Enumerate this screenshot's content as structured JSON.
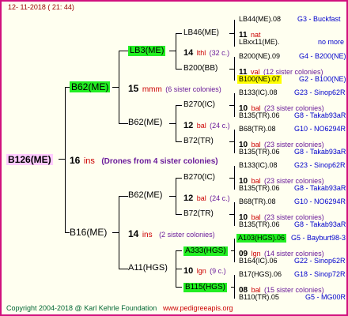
{
  "header": {
    "timestamp": "12- 11-2018 ( 21: 44)"
  },
  "tree": {
    "root": {
      "name": "B126(ME)"
    },
    "gen1": {
      "label": "16",
      "code": "ins",
      "note": "(Drones from 4 sister colonies)",
      "top": "B62(ME)",
      "bottom": "B16(ME)"
    },
    "gen2": {
      "b62_label": "15",
      "b62_code": "mmm",
      "b62_note": "(6 sister colonies)",
      "b16_label": "14",
      "b16_code": "ins",
      "b16_note": "(2 sister colonies)",
      "b62_top": "LB3(ME)",
      "b62_bottom": "B62(ME)",
      "b16_top": "B62(ME)",
      "b16_bottom": "A11(HGS)"
    },
    "gen3": {
      "lb3_label": "14",
      "lb3_code": "lthl",
      "lb3_note": "(32 c.)",
      "lb3_top": "LB46(ME)",
      "lb3_bottom": "B200(BB)",
      "b62a_label": "12",
      "b62a_code": "bal",
      "b62a_note": "(24 c.)",
      "b62a_top": "B270(IC)",
      "b62a_bottom": "B72(TR)",
      "b62b_label": "12",
      "b62b_code": "bal",
      "b62b_note": "(24 c.)",
      "b62b_top": "B270(IC)",
      "b62b_bottom": "B72(TR)",
      "a11_label": "10",
      "a11_code": "lgn",
      "a11_note": "(9 c.)",
      "a11_top": "A333(HGS)",
      "a11_bottom": "B115(HGS)"
    },
    "gen4": [
      {
        "name": "LB44(ME).08",
        "origin": "G3 - Buckfast"
      },
      {
        "label": "11",
        "code": "nat"
      },
      {
        "name": "LBxx11(ME).",
        "origin": "no more"
      },
      {
        "name": "B200(NE).09",
        "origin": "G4 - B200(NE)"
      },
      {
        "label": "11",
        "code": "val",
        "note": "(12 sister colonies)"
      },
      {
        "name": "B100(NE).07",
        "origin": "G2 - B100(NE)"
      },
      {
        "name": "B133(IC).08",
        "origin": "G23 - Sinop62R"
      },
      {
        "label": "10",
        "code": "bal",
        "note": "(23 sister colonies)"
      },
      {
        "name": "B135(TR).06",
        "origin": "G8 - Takab93aR"
      },
      {
        "name": "B68(TR).08",
        "origin": "G10 - NO6294R"
      },
      {
        "label": "10",
        "code": "bal",
        "note": "(23 sister colonies)"
      },
      {
        "name": "B135(TR).06",
        "origin": "G8 - Takab93aR"
      },
      {
        "name": "B133(IC).08",
        "origin": "G23 - Sinop62R"
      },
      {
        "label": "10",
        "code": "bal",
        "note": "(23 sister colonies)"
      },
      {
        "name": "B135(TR).06",
        "origin": "G8 - Takab93aR"
      },
      {
        "name": "B68(TR).08",
        "origin": "G10 - NO6294R"
      },
      {
        "label": "10",
        "code": "bal",
        "note": "(23 sister colonies)"
      },
      {
        "name": "B135(TR).06",
        "origin": "G8 - Takab93aR"
      },
      {
        "name": "A103(HGS).06",
        "origin": "G5 - Bayburt98-3"
      },
      {
        "label": "09",
        "code": "lgn",
        "note": "(14 sister colonies)"
      },
      {
        "name": "B164(IC).06",
        "origin": "G22 - Sinop62R"
      },
      {
        "name": "B17(HGS).06",
        "origin": "G18 - Sinop72R"
      },
      {
        "label": "08",
        "code": "bal",
        "note": "(15 sister colonies)"
      },
      {
        "name": "B110(TR).05",
        "origin": "G5 - MG00R"
      }
    ]
  },
  "footer": {
    "copyright": "Copyright 2004-2018 @ Karl Kehrle Foundation",
    "site": "www.pedigreeapis.org"
  },
  "colors": {
    "border": "#d1117e",
    "highlight_green": "#22ee22",
    "highlight_yellow": "#ffff00",
    "highlight_pink": "#ffccff"
  }
}
